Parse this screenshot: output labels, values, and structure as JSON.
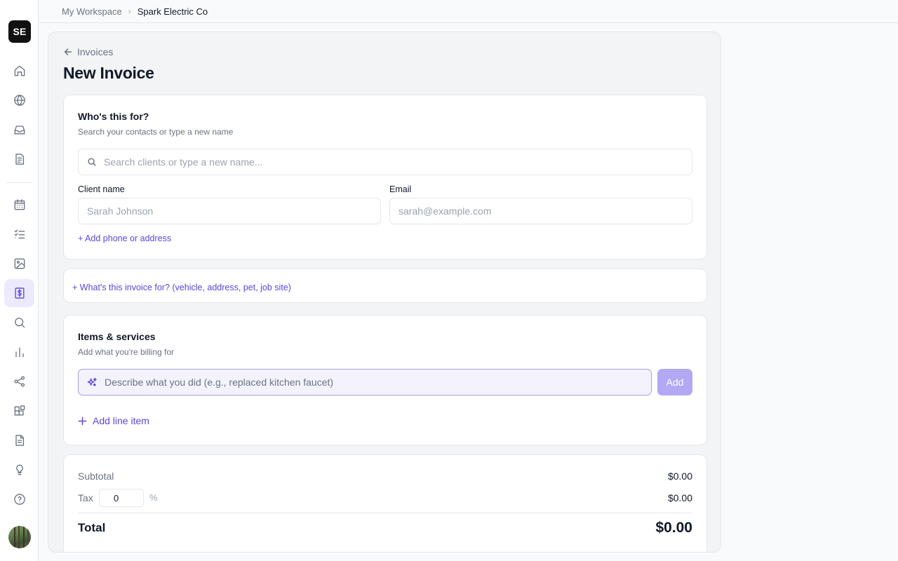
{
  "sidebar": {
    "logo": "SE",
    "nav": [
      {
        "name": "home-icon",
        "active": false
      },
      {
        "name": "globe-icon",
        "active": false
      },
      {
        "name": "inbox-icon",
        "active": false
      },
      {
        "name": "document-icon",
        "active": false
      },
      {
        "name": "calendar-icon",
        "active": false
      },
      {
        "name": "checklist-icon",
        "active": false
      },
      {
        "name": "image-icon",
        "active": false
      },
      {
        "name": "invoice-dollar-icon",
        "active": true
      },
      {
        "name": "search-icon",
        "active": false
      },
      {
        "name": "bar-chart-icon",
        "active": false
      },
      {
        "name": "share-icon",
        "active": false
      },
      {
        "name": "integrations-icon",
        "active": false
      },
      {
        "name": "file-text-icon",
        "active": false
      },
      {
        "name": "lightbulb-icon",
        "active": false
      },
      {
        "name": "help-icon",
        "active": false
      }
    ],
    "accent_color": "#5b46d9"
  },
  "breadcrumb": {
    "workspace": "My Workspace",
    "separator": "›",
    "current": "Spark Electric Co"
  },
  "page": {
    "back_label": "Invoices",
    "title": "New Invoice"
  },
  "client_card": {
    "title": "Who's this for?",
    "subtitle": "Search your contacts or type a new name",
    "search_placeholder": "Search clients or type a new name...",
    "client_name_label": "Client name",
    "client_name_placeholder": "Sarah Johnson",
    "email_label": "Email",
    "email_placeholder": "sarah@example.com",
    "add_contact_link": "+ Add phone or address"
  },
  "subject_card": {
    "link": "+ What's this invoice for? (vehicle, address, pet, job site)"
  },
  "items_card": {
    "title": "Items & services",
    "subtitle": "Add what you're billing for",
    "describe_placeholder": "Describe what you did (e.g., replaced kitchen faucet)",
    "add_button": "Add",
    "add_line_item": "Add line item"
  },
  "summary": {
    "subtotal_label": "Subtotal",
    "subtotal_value": "$0.00",
    "tax_label": "Tax",
    "tax_rate": "0",
    "tax_unit": "%",
    "tax_value": "$0.00",
    "total_label": "Total",
    "total_value": "$0.00"
  }
}
